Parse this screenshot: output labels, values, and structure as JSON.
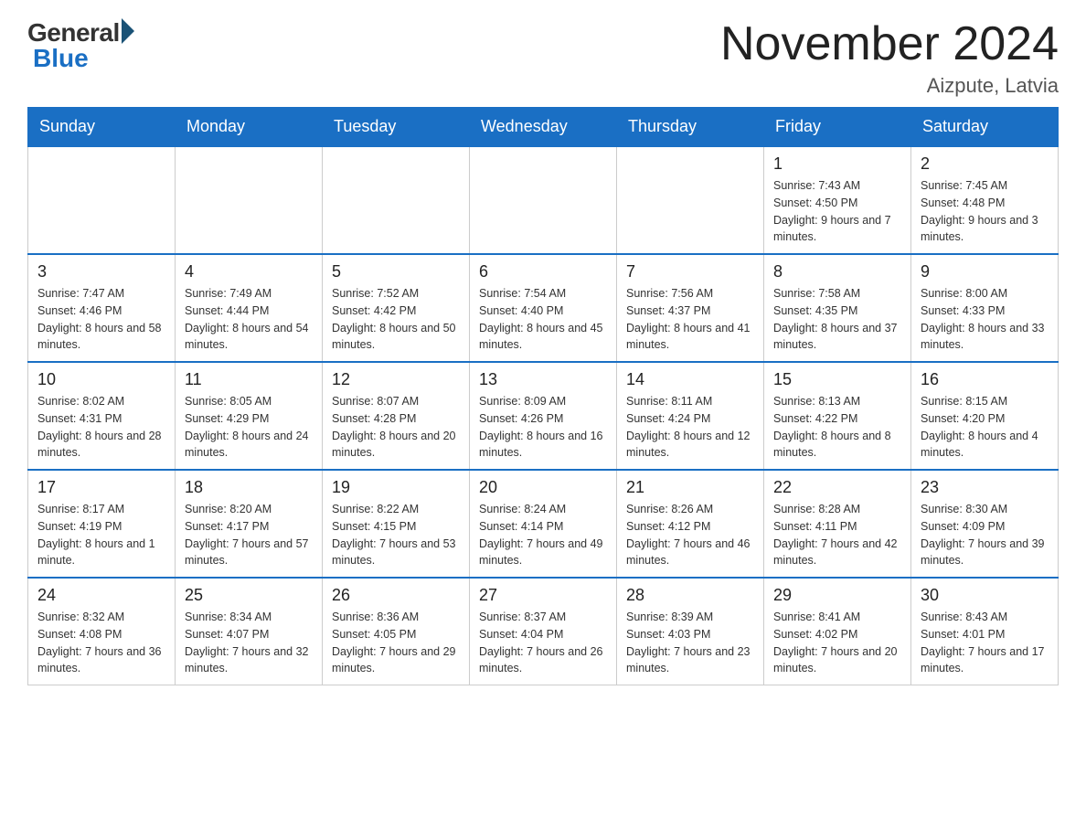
{
  "header": {
    "logo": {
      "general": "General",
      "blue": "Blue"
    },
    "title": "November 2024",
    "subtitle": "Aizpute, Latvia"
  },
  "days_of_week": [
    "Sunday",
    "Monday",
    "Tuesday",
    "Wednesday",
    "Thursday",
    "Friday",
    "Saturday"
  ],
  "weeks": [
    [
      {
        "day": "",
        "info": ""
      },
      {
        "day": "",
        "info": ""
      },
      {
        "day": "",
        "info": ""
      },
      {
        "day": "",
        "info": ""
      },
      {
        "day": "",
        "info": ""
      },
      {
        "day": "1",
        "info": "Sunrise: 7:43 AM\nSunset: 4:50 PM\nDaylight: 9 hours and 7 minutes."
      },
      {
        "day": "2",
        "info": "Sunrise: 7:45 AM\nSunset: 4:48 PM\nDaylight: 9 hours and 3 minutes."
      }
    ],
    [
      {
        "day": "3",
        "info": "Sunrise: 7:47 AM\nSunset: 4:46 PM\nDaylight: 8 hours and 58 minutes."
      },
      {
        "day": "4",
        "info": "Sunrise: 7:49 AM\nSunset: 4:44 PM\nDaylight: 8 hours and 54 minutes."
      },
      {
        "day": "5",
        "info": "Sunrise: 7:52 AM\nSunset: 4:42 PM\nDaylight: 8 hours and 50 minutes."
      },
      {
        "day": "6",
        "info": "Sunrise: 7:54 AM\nSunset: 4:40 PM\nDaylight: 8 hours and 45 minutes."
      },
      {
        "day": "7",
        "info": "Sunrise: 7:56 AM\nSunset: 4:37 PM\nDaylight: 8 hours and 41 minutes."
      },
      {
        "day": "8",
        "info": "Sunrise: 7:58 AM\nSunset: 4:35 PM\nDaylight: 8 hours and 37 minutes."
      },
      {
        "day": "9",
        "info": "Sunrise: 8:00 AM\nSunset: 4:33 PM\nDaylight: 8 hours and 33 minutes."
      }
    ],
    [
      {
        "day": "10",
        "info": "Sunrise: 8:02 AM\nSunset: 4:31 PM\nDaylight: 8 hours and 28 minutes."
      },
      {
        "day": "11",
        "info": "Sunrise: 8:05 AM\nSunset: 4:29 PM\nDaylight: 8 hours and 24 minutes."
      },
      {
        "day": "12",
        "info": "Sunrise: 8:07 AM\nSunset: 4:28 PM\nDaylight: 8 hours and 20 minutes."
      },
      {
        "day": "13",
        "info": "Sunrise: 8:09 AM\nSunset: 4:26 PM\nDaylight: 8 hours and 16 minutes."
      },
      {
        "day": "14",
        "info": "Sunrise: 8:11 AM\nSunset: 4:24 PM\nDaylight: 8 hours and 12 minutes."
      },
      {
        "day": "15",
        "info": "Sunrise: 8:13 AM\nSunset: 4:22 PM\nDaylight: 8 hours and 8 minutes."
      },
      {
        "day": "16",
        "info": "Sunrise: 8:15 AM\nSunset: 4:20 PM\nDaylight: 8 hours and 4 minutes."
      }
    ],
    [
      {
        "day": "17",
        "info": "Sunrise: 8:17 AM\nSunset: 4:19 PM\nDaylight: 8 hours and 1 minute."
      },
      {
        "day": "18",
        "info": "Sunrise: 8:20 AM\nSunset: 4:17 PM\nDaylight: 7 hours and 57 minutes."
      },
      {
        "day": "19",
        "info": "Sunrise: 8:22 AM\nSunset: 4:15 PM\nDaylight: 7 hours and 53 minutes."
      },
      {
        "day": "20",
        "info": "Sunrise: 8:24 AM\nSunset: 4:14 PM\nDaylight: 7 hours and 49 minutes."
      },
      {
        "day": "21",
        "info": "Sunrise: 8:26 AM\nSunset: 4:12 PM\nDaylight: 7 hours and 46 minutes."
      },
      {
        "day": "22",
        "info": "Sunrise: 8:28 AM\nSunset: 4:11 PM\nDaylight: 7 hours and 42 minutes."
      },
      {
        "day": "23",
        "info": "Sunrise: 8:30 AM\nSunset: 4:09 PM\nDaylight: 7 hours and 39 minutes."
      }
    ],
    [
      {
        "day": "24",
        "info": "Sunrise: 8:32 AM\nSunset: 4:08 PM\nDaylight: 7 hours and 36 minutes."
      },
      {
        "day": "25",
        "info": "Sunrise: 8:34 AM\nSunset: 4:07 PM\nDaylight: 7 hours and 32 minutes."
      },
      {
        "day": "26",
        "info": "Sunrise: 8:36 AM\nSunset: 4:05 PM\nDaylight: 7 hours and 29 minutes."
      },
      {
        "day": "27",
        "info": "Sunrise: 8:37 AM\nSunset: 4:04 PM\nDaylight: 7 hours and 26 minutes."
      },
      {
        "day": "28",
        "info": "Sunrise: 8:39 AM\nSunset: 4:03 PM\nDaylight: 7 hours and 23 minutes."
      },
      {
        "day": "29",
        "info": "Sunrise: 8:41 AM\nSunset: 4:02 PM\nDaylight: 7 hours and 20 minutes."
      },
      {
        "day": "30",
        "info": "Sunrise: 8:43 AM\nSunset: 4:01 PM\nDaylight: 7 hours and 17 minutes."
      }
    ]
  ]
}
